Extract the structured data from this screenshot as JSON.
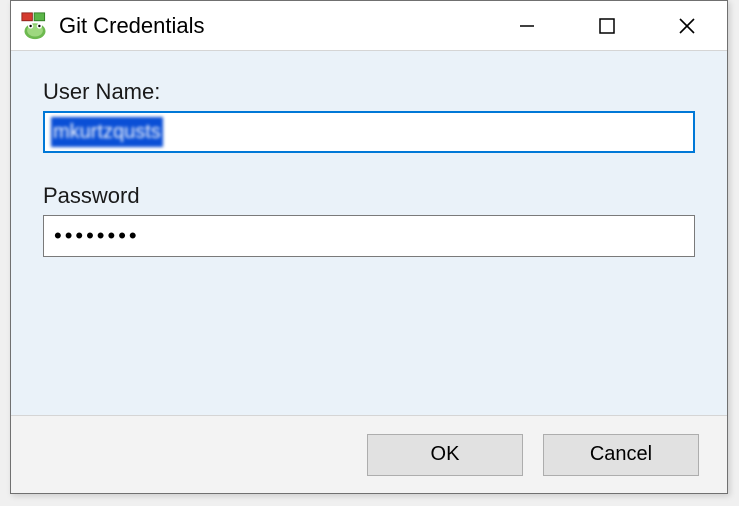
{
  "titlebar": {
    "title": "Git Credentials"
  },
  "form": {
    "username_label": "User Name:",
    "username_value": "mkurtzqusts",
    "password_label": "Password",
    "password_value": "••••••••"
  },
  "buttons": {
    "ok": "OK",
    "cancel": "Cancel"
  }
}
